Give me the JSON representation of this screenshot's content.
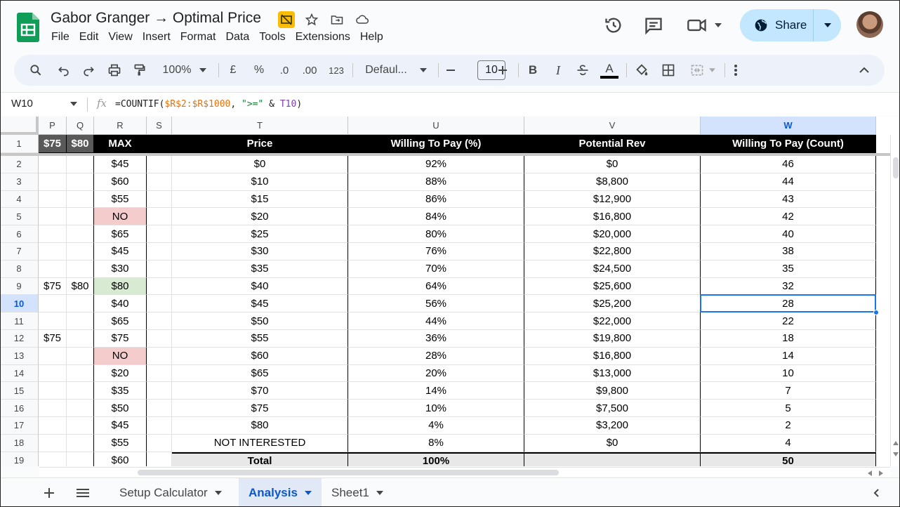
{
  "app": {
    "title": "Gabor Granger → Optimal Price",
    "menu": [
      "File",
      "Edit",
      "View",
      "Insert",
      "Format",
      "Data",
      "Tools",
      "Extensions",
      "Help"
    ],
    "share_label": "Share"
  },
  "toolbar": {
    "zoom": "100%",
    "currency": "£",
    "percent": "%",
    "dec_decrease": ".0",
    "dec_increase": ".00",
    "number_format": "123",
    "font": "Defaul...",
    "font_size": "10",
    "bold": "B",
    "italic": "I",
    "text_color": "A"
  },
  "formula_bar": {
    "name_box": "W10",
    "fx": "fx",
    "formula_prefix": "=COUNTIF(",
    "formula_ref1": "$R$2:$R$1000",
    "formula_mid": ", ",
    "formula_str": "\">=\"",
    "formula_amp": " & ",
    "formula_ref2": "T10",
    "formula_end": ")"
  },
  "columns": [
    "P",
    "Q",
    "R",
    "S",
    "T",
    "U",
    "V",
    "W"
  ],
  "selected_column": "W",
  "header_row": {
    "P": "$75",
    "Q": "$80",
    "R": "MAX",
    "S": "",
    "T": "Price",
    "U": "Willing To Pay (%)",
    "V": "Potential Rev",
    "W": "Willing To Pay (Count)"
  },
  "rows": [
    {
      "n": "2",
      "P": "",
      "Q": "",
      "R": "$45",
      "T": "$0",
      "U": "92%",
      "V": "$0",
      "W": "46"
    },
    {
      "n": "3",
      "P": "",
      "Q": "",
      "R": "$60",
      "T": "$10",
      "U": "88%",
      "V": "$8,800",
      "W": "44"
    },
    {
      "n": "4",
      "P": "",
      "Q": "",
      "R": "$55",
      "T": "$15",
      "U": "86%",
      "V": "$12,900",
      "W": "43"
    },
    {
      "n": "5",
      "P": "",
      "Q": "",
      "R": "NO",
      "T": "$20",
      "U": "84%",
      "V": "$16,800",
      "W": "42"
    },
    {
      "n": "6",
      "P": "",
      "Q": "",
      "R": "$65",
      "T": "$25",
      "U": "80%",
      "V": "$20,000",
      "W": "40"
    },
    {
      "n": "7",
      "P": "",
      "Q": "",
      "R": "$45",
      "T": "$30",
      "U": "76%",
      "V": "$22,800",
      "W": "38"
    },
    {
      "n": "8",
      "P": "",
      "Q": "",
      "R": "$30",
      "T": "$35",
      "U": "70%",
      "V": "$24,500",
      "W": "35"
    },
    {
      "n": "9",
      "P": "$75",
      "Q": "$80",
      "R": "$80",
      "T": "$40",
      "U": "64%",
      "V": "$25,600",
      "W": "32"
    },
    {
      "n": "10",
      "P": "",
      "Q": "",
      "R": "$40",
      "T": "$45",
      "U": "56%",
      "V": "$25,200",
      "W": "28"
    },
    {
      "n": "11",
      "P": "",
      "Q": "",
      "R": "$65",
      "T": "$50",
      "U": "44%",
      "V": "$22,000",
      "W": "22"
    },
    {
      "n": "12",
      "P": "$75",
      "Q": "",
      "R": "$75",
      "T": "$55",
      "U": "36%",
      "V": "$19,800",
      "W": "18"
    },
    {
      "n": "13",
      "P": "",
      "Q": "",
      "R": "NO",
      "T": "$60",
      "U": "28%",
      "V": "$16,800",
      "W": "14"
    },
    {
      "n": "14",
      "P": "",
      "Q": "",
      "R": "$20",
      "T": "$65",
      "U": "20%",
      "V": "$13,000",
      "W": "10"
    },
    {
      "n": "15",
      "P": "",
      "Q": "",
      "R": "$35",
      "T": "$70",
      "U": "14%",
      "V": "$9,800",
      "W": "7"
    },
    {
      "n": "16",
      "P": "",
      "Q": "",
      "R": "$50",
      "T": "$75",
      "U": "10%",
      "V": "$7,500",
      "W": "5"
    },
    {
      "n": "17",
      "P": "",
      "Q": "",
      "R": "$45",
      "T": "$80",
      "U": "4%",
      "V": "$3,200",
      "W": "2"
    },
    {
      "n": "18",
      "P": "",
      "Q": "",
      "R": "$55",
      "T": "NOT INTERESTED",
      "U": "8%",
      "V": "$0",
      "W": "4"
    },
    {
      "n": "19",
      "P": "",
      "Q": "",
      "R": "$60",
      "T": "Total",
      "U": "100%",
      "V": "",
      "W": "50"
    }
  ],
  "selected_row": "10",
  "highlight": {
    "pink": "#f4cccc",
    "green": "#d9ead3",
    "selection": "#1a73e8"
  },
  "sheets": [
    {
      "label": "Setup Calculator",
      "active": false
    },
    {
      "label": "Analysis",
      "active": true
    },
    {
      "label": "Sheet1",
      "active": false
    }
  ]
}
